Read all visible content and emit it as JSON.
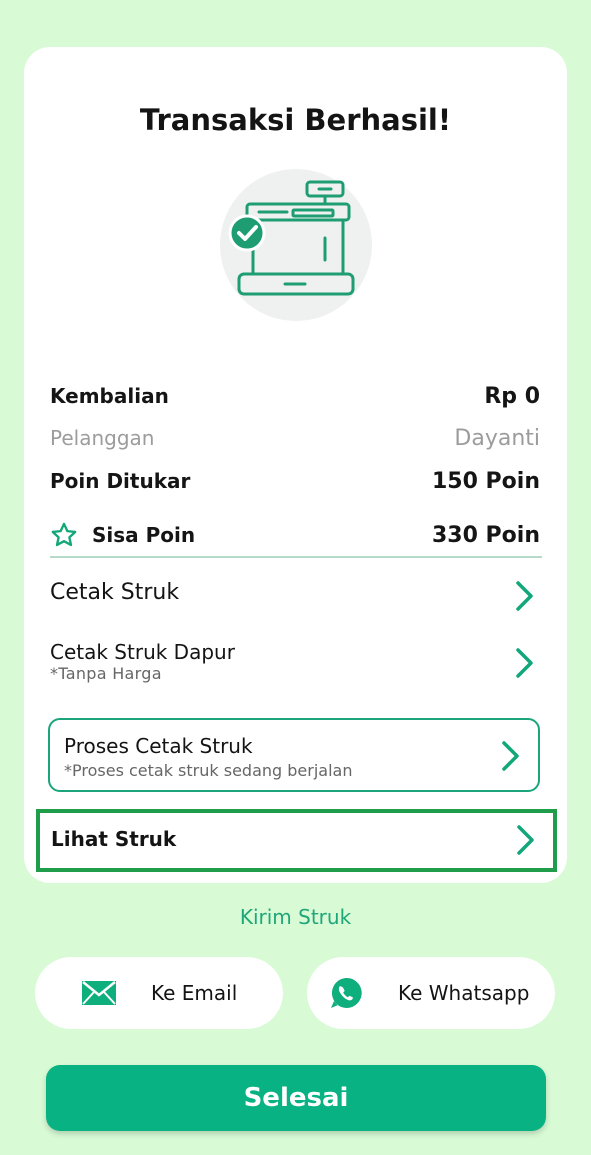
{
  "title": "Transaksi Berhasil!",
  "summary": {
    "kembalian_label": "Kembalian",
    "kembalian_value": "Rp 0",
    "pelanggan_label": "Pelanggan",
    "pelanggan_value": "Dayanti",
    "poin_ditukar_label": "Poin Ditukar",
    "poin_ditukar_value": "150 Poin",
    "sisa_poin_label": "Sisa Poin",
    "sisa_poin_value": "330 Poin"
  },
  "menu": {
    "cetak_struk": "Cetak Struk",
    "cetak_struk_dapur": "Cetak Struk Dapur",
    "cetak_struk_dapur_note": "*Tanpa Harga",
    "proses_title": "Proses Cetak Struk",
    "proses_note": "*Proses cetak struk sedang berjalan",
    "lihat_struk": "Lihat Struk"
  },
  "share": {
    "heading": "Kirim Struk",
    "email": "Ke Email",
    "whatsapp": "Ke Whatsapp"
  },
  "done_label": "Selesai",
  "colors": {
    "accent": "#08b283",
    "background": "#d8fbd6",
    "highlight_border": "#1f9d4a"
  },
  "icons": [
    "cash-register-icon",
    "check-circle-icon",
    "star-icon",
    "chevron-right-icon",
    "email-icon",
    "whatsapp-icon"
  ]
}
